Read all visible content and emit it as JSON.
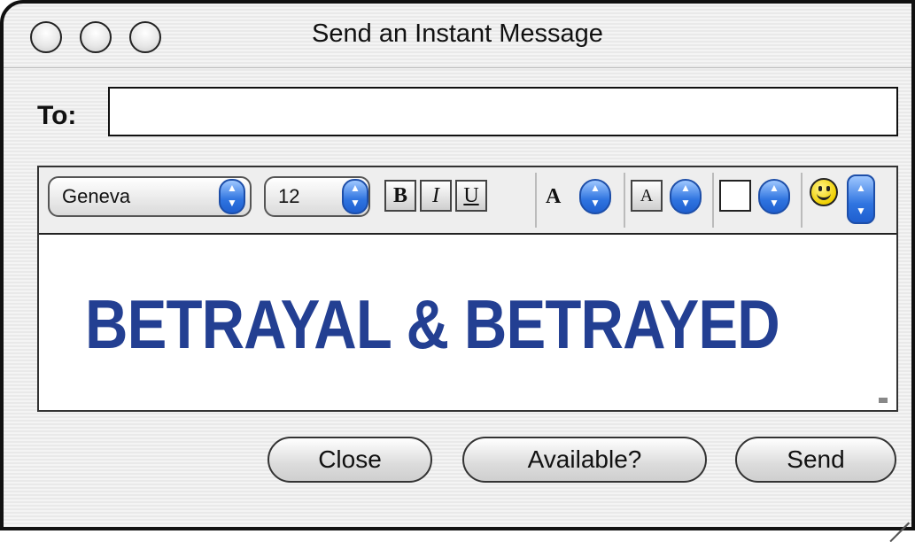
{
  "window": {
    "title": "Send an Instant Message"
  },
  "to": {
    "label": "To:",
    "value": "",
    "placeholder": ""
  },
  "toolbar": {
    "font": "Geneva",
    "size": "12",
    "bold": "B",
    "italic": "I",
    "underline": "U",
    "text_color_glyph": "A",
    "bg_color_glyph": "A",
    "icons": [
      "up-down-stepper-icon",
      "smiley-icon",
      "color-swatch-icon",
      "resize-grip-icon"
    ]
  },
  "message": {
    "text": "BETRAYAL & BETRAYED",
    "color": "#233f92"
  },
  "buttons": {
    "close": "Close",
    "available": "Available?",
    "send": "Send"
  }
}
